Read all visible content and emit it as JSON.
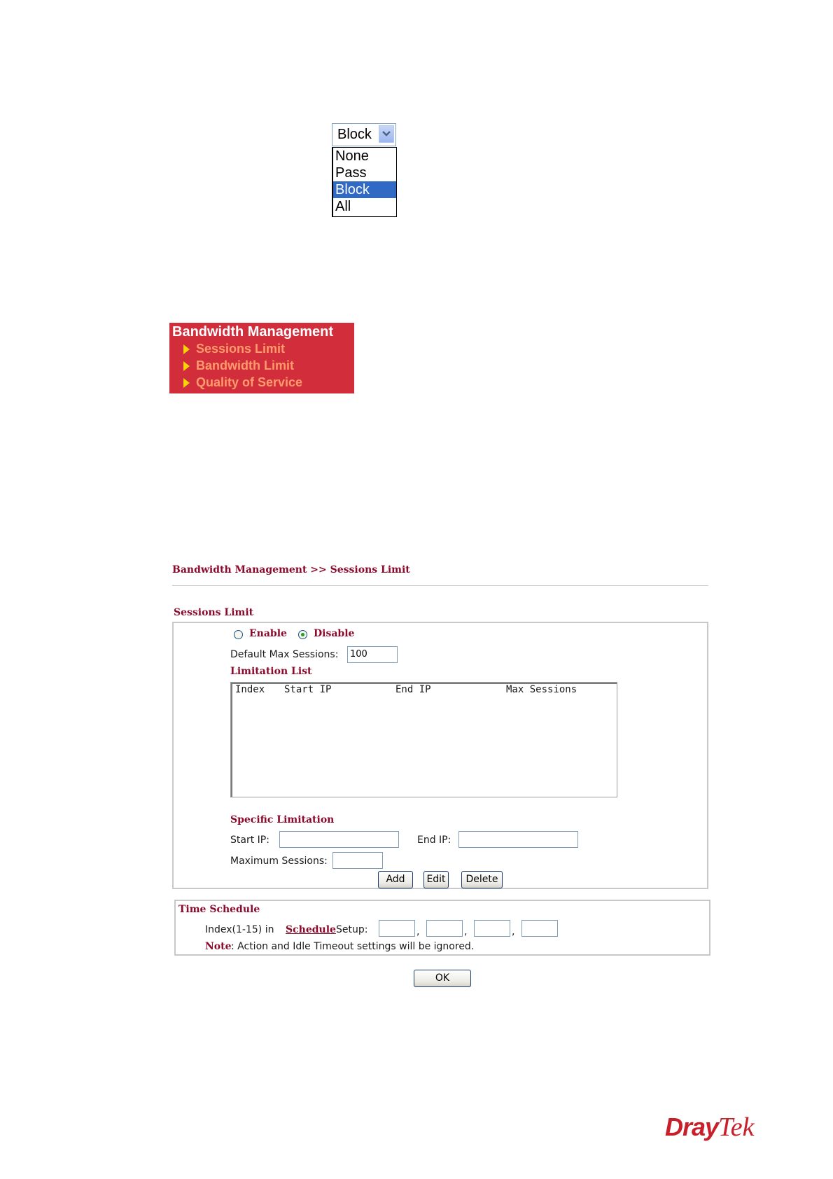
{
  "dropdown": {
    "selected": "Block",
    "options": [
      "None",
      "Pass",
      "Block",
      "All"
    ],
    "highlighted_index": 2
  },
  "menu": {
    "title": "Bandwidth Management",
    "items": [
      "Sessions Limit",
      "Bandwidth Limit",
      "Quality of Service"
    ],
    "bg_color": "#d12d3a",
    "item_color": "#ff9a6c",
    "bullet_color": "#f6d30b"
  },
  "page": {
    "breadcrumb": "Bandwidth Management >> Sessions Limit",
    "sessions_limit": {
      "title": "Sessions Limit",
      "enable_label": "Enable",
      "disable_label": "Disable",
      "selected": "Disable",
      "default_max_label": "Default Max Sessions:",
      "default_max_value": "100",
      "limitation_list_title": "Limitation List",
      "list_headers": [
        "Index",
        "Start IP",
        "End IP",
        "Max Sessions"
      ],
      "specific_title": "Specific Limitation",
      "start_ip_label": "Start IP:",
      "end_ip_label": "End IP:",
      "max_sessions_label": "Maximum Sessions:",
      "add_label": "Add",
      "edit_label": "Edit",
      "delete_label": "Delete"
    },
    "time_schedule": {
      "title": "Time Schedule",
      "index_prefix": "Index(1-15) in",
      "schedule_link": "Schedule",
      "setup_suffix": "Setup:",
      "separator": ",",
      "note_label": "Note",
      "note_text": ": Action and Idle Timeout settings will be ignored."
    },
    "ok_label": "OK",
    "accent_color": "#8b0a2c"
  },
  "logo": {
    "part1": "Dray",
    "part2": "Tek"
  }
}
